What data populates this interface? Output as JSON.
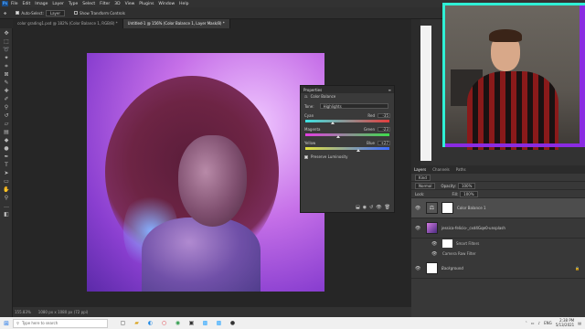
{
  "menubar": {
    "items": [
      "File",
      "Edit",
      "Image",
      "Layer",
      "Type",
      "Select",
      "Filter",
      "3D",
      "View",
      "Plugins",
      "Window",
      "Help"
    ]
  },
  "options": {
    "auto_select": "Auto-Select:",
    "auto_select_target": "Layer",
    "show_transform": "Show Transform Controls"
  },
  "tabs": [
    {
      "label": "color grading1.psd @ 182% (Color Balance 1, RGB/8) *"
    },
    {
      "label": "Untitled-1 @ 156% (Color Balance 1, Layer Mask/8) *"
    }
  ],
  "properties": {
    "title": "Properties",
    "adjustment": "Color Balance",
    "tone_label": "Tone:",
    "tone_value": "Highlights",
    "sliders": [
      {
        "left": "Cyan",
        "right": "Red",
        "value": "-35",
        "level": 0.33,
        "color": "#e23d3d"
      },
      {
        "left": "Magenta",
        "right": "Green",
        "value": "-23",
        "level": 0.39,
        "color": "#3ddc4b"
      },
      {
        "left": "Yellow",
        "right": "Blue",
        "value": "+27",
        "level": 0.63,
        "color": "#3d6bff"
      }
    ],
    "preserve_luminosity": "Preserve Luminosity"
  },
  "layers_panel": {
    "tabs": [
      "Layers",
      "Channels",
      "Paths"
    ],
    "kind": "Kind",
    "blend": "Normal",
    "opacity_label": "Opacity:",
    "opacity": "100%",
    "lock_label": "Lock:",
    "fill_label": "Fill:",
    "fill": "100%",
    "layers": [
      {
        "name": "Color Balance 1",
        "type": "adjustment"
      },
      {
        "name": "jessica-felicio-_cxd4Gqe0-unsplash",
        "type": "image"
      },
      {
        "name": "Background",
        "type": "background"
      }
    ],
    "sub_items": [
      "Smart Filters",
      "Camera Raw Filter"
    ]
  },
  "status": {
    "zoom": "155.83%",
    "doc": "1080 px x 1080 px (72 ppi)"
  },
  "taskbar": {
    "search_placeholder": "Type here to search",
    "lang": "ENG",
    "time": "2:38 PM",
    "date": "5/13/2021"
  },
  "colors": {
    "accent_teal": "#2ff0d5",
    "accent_purple": "#8a2be2"
  }
}
